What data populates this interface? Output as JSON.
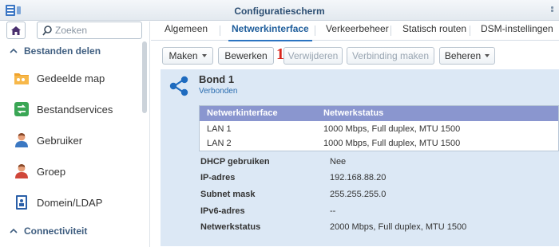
{
  "window": {
    "title": "Configuratiescherm"
  },
  "sidebar": {
    "search_placeholder": "Zoeken",
    "sections": [
      {
        "label": "Bestanden delen"
      },
      {
        "label": "Connectiviteit"
      }
    ],
    "items": [
      {
        "label": "Gedeelde map",
        "icon": "shared-folder-icon"
      },
      {
        "label": "Bestandservices",
        "icon": "file-services-icon"
      },
      {
        "label": "Gebruiker",
        "icon": "user-icon"
      },
      {
        "label": "Groep",
        "icon": "group-icon"
      },
      {
        "label": "Domein/LDAP",
        "icon": "domain-ldap-icon"
      }
    ]
  },
  "tabs": [
    {
      "label": "Algemeen"
    },
    {
      "label": "Netwerkinterface",
      "active": true
    },
    {
      "label": "Verkeerbeheer"
    },
    {
      "label": "Statisch routen"
    },
    {
      "label": "DSM-instellingen"
    }
  ],
  "toolbar": {
    "create": "Maken",
    "edit": "Bewerken",
    "delete": "Verwijderen",
    "connect": "Verbinding maken",
    "manage": "Beheren",
    "marker": "1"
  },
  "bond": {
    "title": "Bond 1",
    "status": "Verbonden",
    "table": {
      "headers": [
        "Netwerkinterface",
        "Netwerkstatus"
      ],
      "rows": [
        [
          "LAN 1",
          "1000 Mbps, Full duplex, MTU 1500"
        ],
        [
          "LAN 2",
          "1000 Mbps, Full duplex, MTU 1500"
        ]
      ]
    },
    "properties": [
      {
        "key": "DHCP gebruiken",
        "value": "Nee"
      },
      {
        "key": "IP-adres",
        "value": "192.168.88.20"
      },
      {
        "key": "Subnet mask",
        "value": "255.255.255.0"
      },
      {
        "key": "IPv6-adres",
        "value": "--"
      },
      {
        "key": "Netwerkstatus",
        "value": "2000 Mbps, Full duplex, MTU 1500"
      }
    ]
  },
  "colors": {
    "accent": "#2b74c2",
    "panel": "#dce8f5",
    "table_header": "#8a96cf",
    "marker": "#d9261c"
  }
}
